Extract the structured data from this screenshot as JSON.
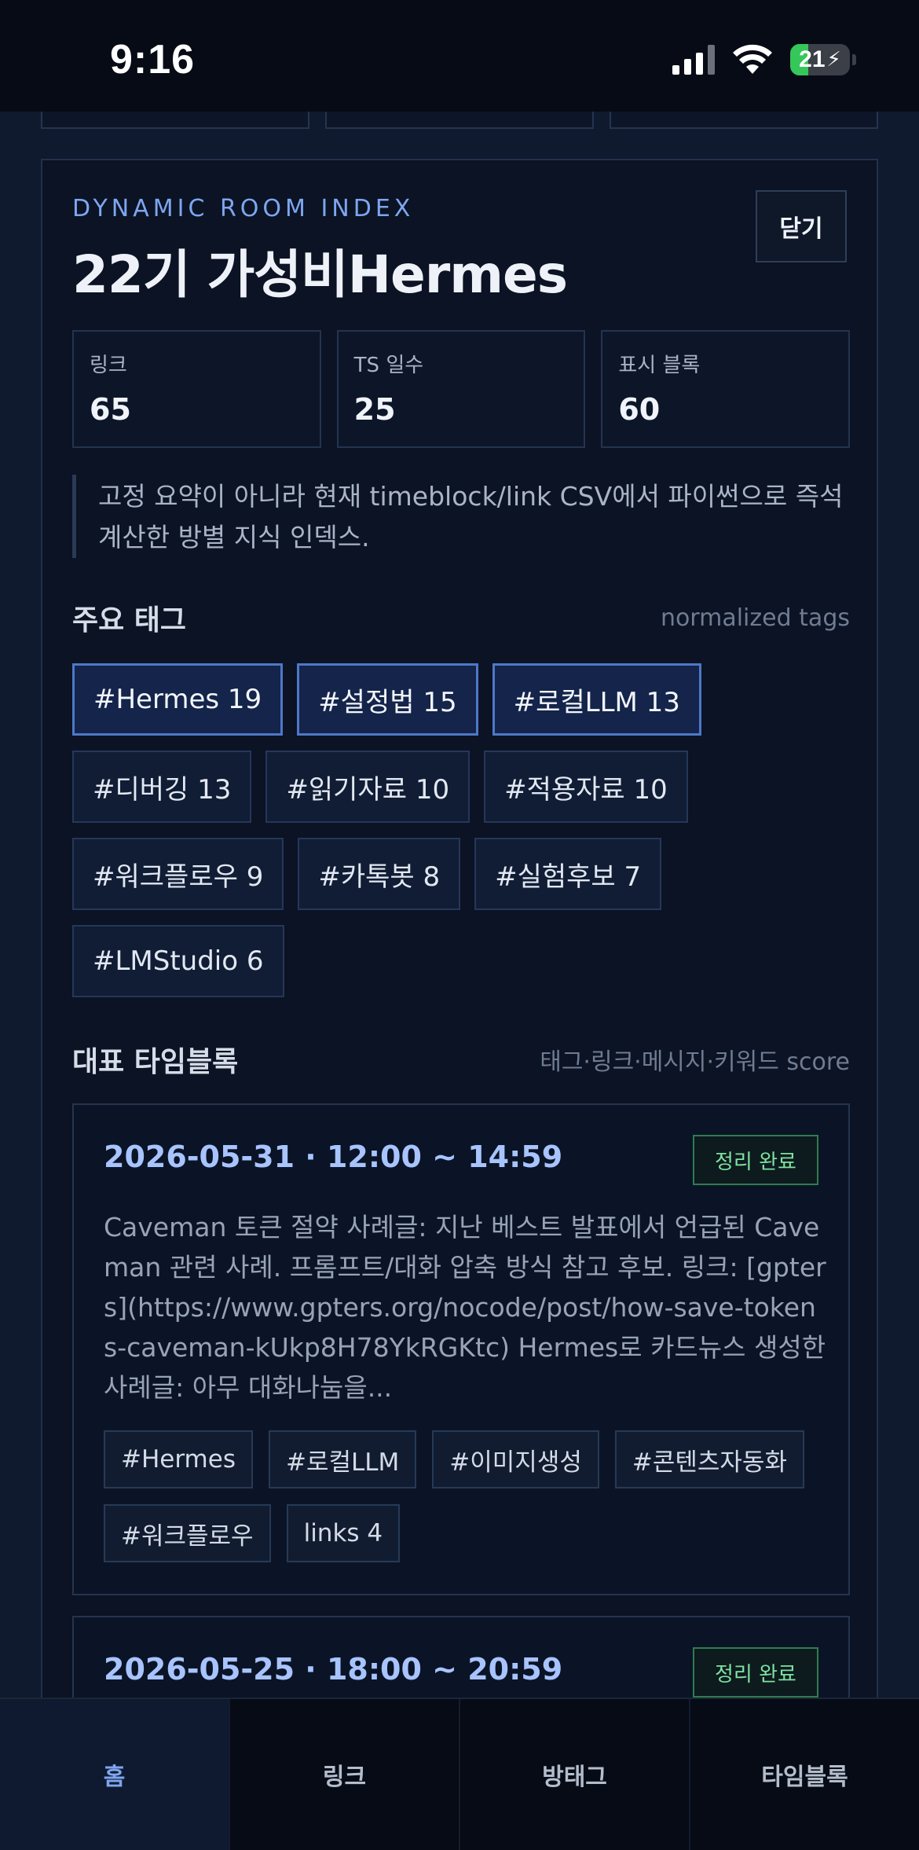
{
  "status_bar": {
    "time": "9:16",
    "battery": "21"
  },
  "header": {
    "eyebrow": "DYNAMIC ROOM INDEX",
    "title": "22기 가성비Hermes",
    "close_label": "닫기"
  },
  "stats": [
    {
      "label": "링크",
      "value": "65"
    },
    {
      "label": "TS 일수",
      "value": "25"
    },
    {
      "label": "표시 블록",
      "value": "60"
    }
  ],
  "summary": "고정 요약이 아니라 현재 timeblock/link CSV에서 파이썬으로 즉석 계산한 방별 지식 인덱스.",
  "tags_section": {
    "title": "주요 태그",
    "meta": "normalized tags",
    "tags": [
      {
        "label": "#Hermes 19"
      },
      {
        "label": "#설정법 15"
      },
      {
        "label": "#로컬LLM 13"
      },
      {
        "label": "#디버깅 13"
      },
      {
        "label": "#읽기자료 10"
      },
      {
        "label": "#적용자료 10"
      },
      {
        "label": "#워크플로우 9"
      },
      {
        "label": "#카톡봇 8"
      },
      {
        "label": "#실험후보 7"
      },
      {
        "label": "#LMStudio 6"
      }
    ]
  },
  "timeblocks_section": {
    "title": "대표 타임블록",
    "meta": "태그·링크·메시지·키워드 score",
    "blocks": [
      {
        "date": "2026-05-31 · 12:00 ~ 14:59",
        "badge": "정리 완료",
        "body": "Caveman 토큰 절약 사례글: 지난 베스트 발표에서 언급된 Caveman 관련 사례. 프롬프트/대화 압축 방식 참고 후보. 링크: [gpters](https://www.gpters.org/nocode/post/how-save-tokens-caveman-kUkp8H78YkRGKtc) Hermes로 카드뉴스 생성한 사례글: 아무 대화나눔을...",
        "tags": [
          "#Hermes",
          "#로컬LLM",
          "#이미지생성",
          "#콘텐츠자동화",
          "#워크플로우",
          "links 4"
        ]
      },
      {
        "date": "2026-05-25 · 18:00 ~ 20:59",
        "badge": "정리 완료"
      }
    ]
  },
  "nav": {
    "items": [
      {
        "label": "홈"
      },
      {
        "label": "링크"
      },
      {
        "label": "방태그"
      },
      {
        "label": "타임블록"
      }
    ]
  }
}
